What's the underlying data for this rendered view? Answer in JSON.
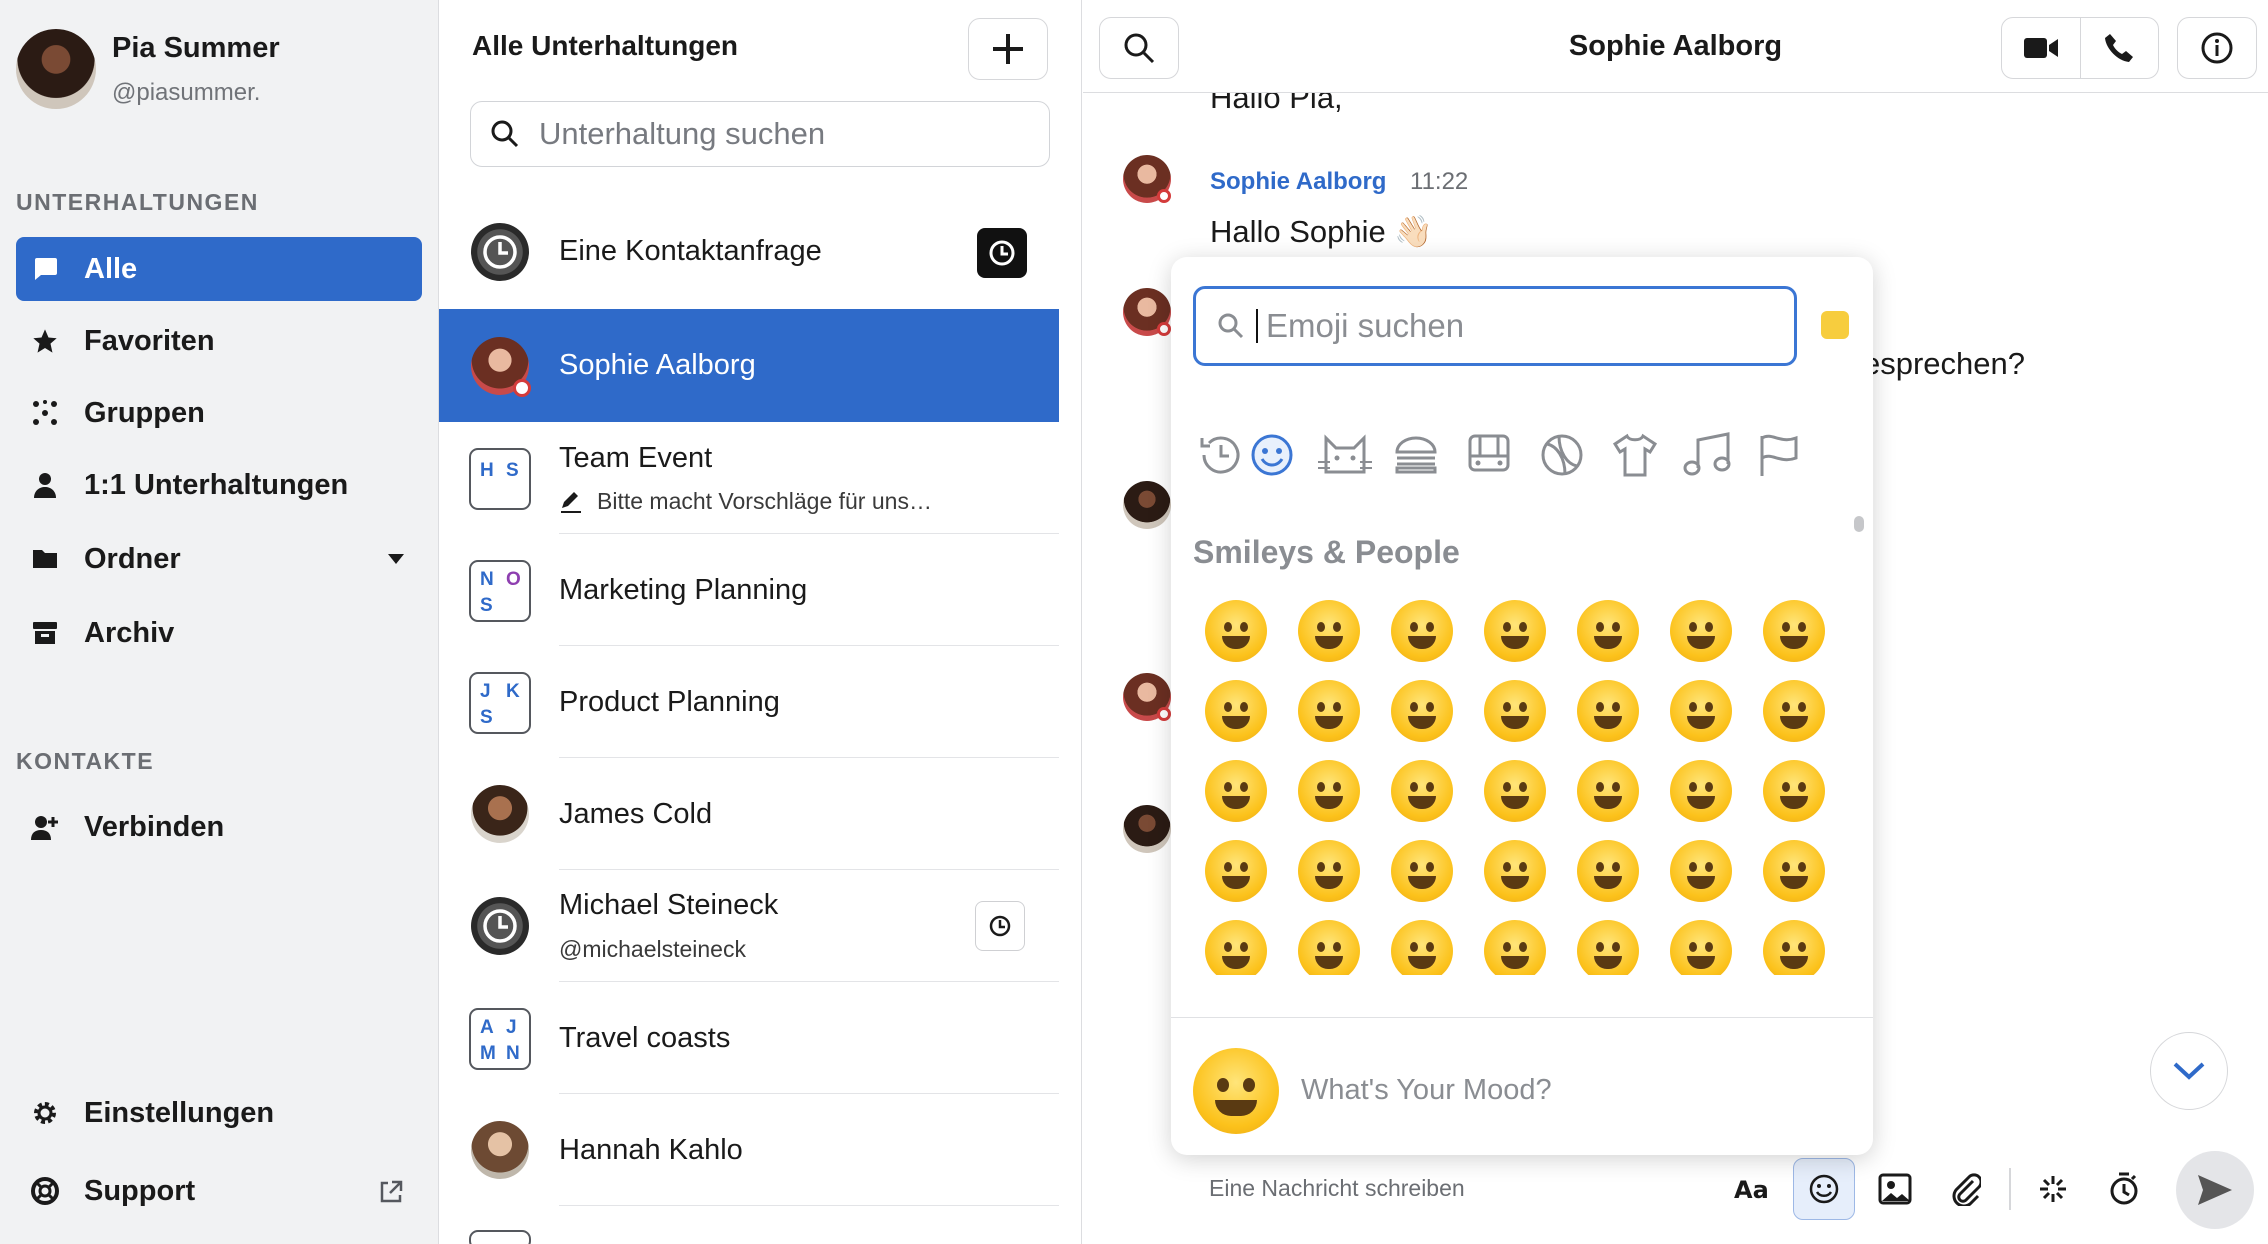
{
  "user": {
    "name": "Pia Summer",
    "handle": "@piasummer."
  },
  "sidebar": {
    "section_conversations": "UNTERHALTUNGEN",
    "items": [
      {
        "label": "Alle",
        "icon": "chat-bubble-icon",
        "active": true
      },
      {
        "label": "Favoriten",
        "icon": "star-icon"
      },
      {
        "label": "Gruppen",
        "icon": "group-dots-icon"
      },
      {
        "label": "1:1 Unterhaltungen",
        "icon": "person-icon"
      },
      {
        "label": "Ordner",
        "icon": "folder-icon"
      },
      {
        "label": "Archiv",
        "icon": "archive-icon"
      }
    ],
    "section_contacts": "KONTAKTE",
    "connect": "Verbinden",
    "settings": "Einstellungen",
    "support": "Support"
  },
  "conversations": {
    "title": "Alle Unterhaltungen",
    "search_placeholder": "Unterhaltung suchen",
    "items": [
      {
        "name": "Eine Kontaktanfrage",
        "avatar": "clock-icon",
        "badge": "clock-icon"
      },
      {
        "name": "Sophie Aalborg",
        "selected": true
      },
      {
        "name": "Team Event",
        "initials": [
          "H",
          "S"
        ],
        "preview": "Bitte macht Vorschläge für uns…"
      },
      {
        "name": "Marketing Planning",
        "initials": [
          "N",
          "O",
          "S"
        ]
      },
      {
        "name": "Product Planning",
        "initials": [
          "J",
          "K",
          "S"
        ]
      },
      {
        "name": "James Cold"
      },
      {
        "name": "Michael Steineck",
        "handle": "@michaelsteineck",
        "badge": "clock-icon"
      },
      {
        "name": "Travel coasts",
        "initials": [
          "A",
          "J",
          "M",
          "N"
        ]
      },
      {
        "name": "Hannah Kahlo"
      }
    ]
  },
  "chat": {
    "title": "Sophie Aalborg",
    "messages": {
      "partial_top": "Hallo Pia,",
      "sender": "Sophie Aalborg",
      "time": "11:22",
      "greeting": "Hallo Sophie 👋🏻",
      "partial_right": "esprechen?"
    },
    "composer_placeholder": "Eine Nachricht schreiben"
  },
  "emoji_picker": {
    "search_placeholder": "Emoji suchen",
    "categories": [
      "recent-clock-icon",
      "smiley-icon",
      "cat-icon",
      "burger-icon",
      "bus-icon",
      "ball-icon",
      "shirt-icon",
      "music-note-icon",
      "flag-icon"
    ],
    "section_title": "Smileys & People",
    "mood_placeholder": "What's Your Mood?"
  },
  "colors": {
    "accent": "#2f6ac9",
    "sidebar_bg": "#f1f2f3",
    "emoji_yellow": "#fcc21b"
  }
}
